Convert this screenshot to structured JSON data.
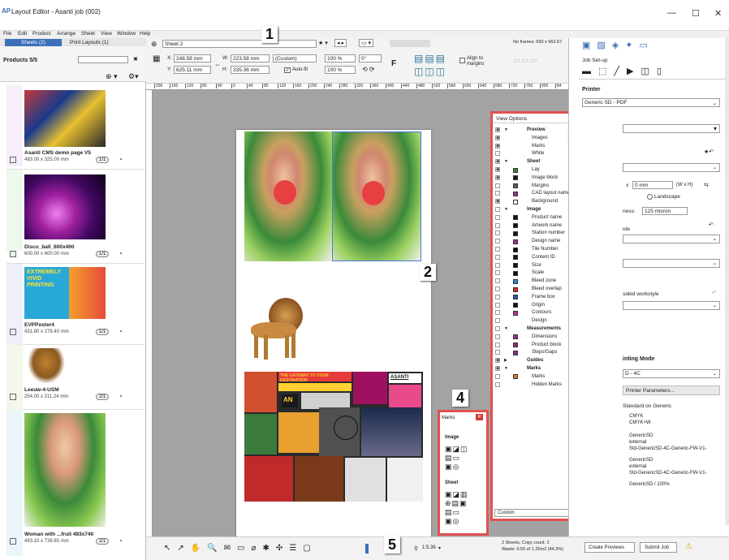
{
  "window": {
    "title": "Layout Editor - Asanti job (002)",
    "min": "—",
    "max": "☐",
    "close": "✕"
  },
  "menu": [
    "File",
    "Edit",
    "Product",
    "Arrange",
    "Sheet",
    "View",
    "Window",
    "Help"
  ],
  "left": {
    "tabs": [
      "Sheets (2)",
      "Print Layouts (1)"
    ],
    "products_label": "Products 5/5",
    "filter_close": "✖",
    "cards": [
      {
        "title": "Asanti CMS demo page V5",
        "size": "483.00 x 325.00 mm",
        "count": "1/1",
        "color": "#c8a8e0"
      },
      {
        "title": "Disco_ball_600x400",
        "size": "600.00 x 400.00 mm",
        "count": "1/1",
        "color": "#a8d8a8"
      },
      {
        "title": "EVPPoster4",
        "size": "431.80 x 279.40 mm",
        "count": "1/1",
        "color": "#a8b8e8"
      },
      {
        "title": "Leeuw-4-USM",
        "size": "254.00 x 211.24 mm",
        "count": "2/1",
        "color": "#b8d890"
      },
      {
        "title": "Woman with ...fruit 493x740",
        "size": "493.10 x 739.65 mm",
        "count": "2/1",
        "color": "#a8d8e8"
      }
    ],
    "poster_text": "EXTREMELY VIVID PRINTING"
  },
  "toolbar": {
    "sheet_name": "Sheet 2",
    "frames": "No frames: 650 x 962.67",
    "x": "248.58 mm",
    "y": "625.11 mm",
    "w": "223.58 mm",
    "h": "335.36 mm",
    "preset": "(Custom)",
    "scale1": "100 %",
    "scale2": "100 %",
    "angle": "0°",
    "autofit": "Auto-fit",
    "align": "Align to margins",
    "f_label": "F",
    "labels": {
      "x": "X:",
      "y": "Y:",
      "w": "W:",
      "h": "H:"
    }
  },
  "ruler": [
    "200",
    "160",
    "120",
    "80",
    "40",
    "0",
    "40",
    "80",
    "120",
    "160",
    "200",
    "240",
    "280",
    "320",
    "360",
    "400",
    "440",
    "480",
    "520",
    "560",
    "600",
    "640",
    "680",
    "720",
    "760",
    "800",
    "84"
  ],
  "view_options": {
    "title": "View Options",
    "footer": "Custom",
    "rows": [
      {
        "label": "Preview",
        "bold": true,
        "eye": true,
        "tri": "▼"
      },
      {
        "label": "Images",
        "eye": true,
        "indent": 1
      },
      {
        "label": "Marks",
        "eye": true,
        "indent": 1
      },
      {
        "label": "White",
        "indent": 1
      },
      {
        "label": "Sheet",
        "bold": true,
        "eye": true,
        "tri": "▼"
      },
      {
        "label": "Lay",
        "eye": true,
        "color": "#2a8a3a",
        "indent": 1
      },
      {
        "label": "Image block",
        "eye": true,
        "color": "#111111",
        "line": "#111111",
        "indent": 1
      },
      {
        "label": "Margins",
        "color": "#555555",
        "line": "#111111",
        "indent": 1
      },
      {
        "label": "CAD layout name",
        "color": "#9a2aa0",
        "indent": 1
      },
      {
        "label": "Background",
        "eye": true,
        "color": "#ffffff",
        "indent": 1
      },
      {
        "label": "Image",
        "bold": true,
        "tri": "▼"
      },
      {
        "label": "Product name",
        "color": "#111111",
        "indent": 1
      },
      {
        "label": "Artwork name",
        "color": "#111111",
        "indent": 1
      },
      {
        "label": "Station number",
        "color": "#111111",
        "indent": 1
      },
      {
        "label": "Design name",
        "color": "#9a2aa0",
        "indent": 1
      },
      {
        "label": "Tile Number",
        "color": "#111111",
        "indent": 1
      },
      {
        "label": "Content ID",
        "color": "#111111",
        "indent": 1
      },
      {
        "label": "Size",
        "color": "#111111",
        "indent": 1
      },
      {
        "label": "Scale",
        "color": "#111111",
        "indent": 1
      },
      {
        "label": "Bleed zone",
        "color": "#2a8ad0",
        "indent": 1
      },
      {
        "label": "Bleed overlap",
        "color": "#d02a2a",
        "indent": 1
      },
      {
        "label": "Frame box",
        "color": "#2a4ad0",
        "line": "#3a6ad8",
        "indent": 1
      },
      {
        "label": "Origin",
        "color": "#111111",
        "indent": 1
      },
      {
        "label": "Contours",
        "color": "#d02a8a",
        "line": "#e03a9a",
        "indent": 1
      },
      {
        "label": "Design",
        "indent": 1
      },
      {
        "label": "Measurements",
        "bold": true,
        "tri": "▼"
      },
      {
        "label": "Dimensions",
        "color": "#9a2aa0",
        "indent": 1
      },
      {
        "label": "Product block",
        "color": "#9a2a70",
        "indent": 1
      },
      {
        "label": "Steps/Gaps",
        "color": "#9a2aa0",
        "indent": 1
      },
      {
        "label": "Guides",
        "bold": true,
        "eye": true,
        "tri": "▶"
      },
      {
        "label": "Marks",
        "bold": true,
        "eye": true,
        "tri": "▼"
      },
      {
        "label": "Marks",
        "color": "#e07a2a",
        "line": "#e07a2a",
        "indent": 1
      },
      {
        "label": "Hidden Marks",
        "line": "#e07a2a",
        "indent": 1
      }
    ]
  },
  "marks_panel": {
    "title": "Marks",
    "image_label": "Image",
    "sheet_label": "Sheet"
  },
  "callouts": [
    "1",
    "2",
    "3",
    "4",
    "5"
  ],
  "right": {
    "jobsetup": "Job Set-up",
    "printer_label": "Printer",
    "printer": "Generic SD - PDF",
    "dim_field": "0 mm",
    "dim_label": "(W x H)",
    "landscape": "Landscape",
    "thickness_label": "ness:",
    "thickness": "125 micron",
    "ute": "ute",
    "workstyle": "sided workstyle",
    "printing_mode_label": "inting Mode",
    "printing_mode": "D - 4C",
    "printer_params": "Printer Parameters...",
    "standard": "Standard on Generic",
    "list": [
      "CMYK",
      "CMYK+W",
      "GenericSD",
      "external",
      "Std-GenericSD-4C-Generic-FW-V1-",
      "GenericSD",
      "external",
      "Std-GenericSD-4C-Generic-FW-V1-",
      "GenericSD / 100%"
    ]
  },
  "bottom": {
    "zoom": "1:5.36",
    "status1": "2 Sheets, Copy count: 2",
    "status2": "Waste: 0.55 of 1.25m2 (44.3%)",
    "create_previews": "Create Previews",
    "submit_job": "Submit Job",
    "warn": "⚠"
  },
  "collage": {
    "headline": "THE GATEWAY TO YOUR DESTINATION",
    "asanti": "ASANTI",
    "an": "AN"
  }
}
